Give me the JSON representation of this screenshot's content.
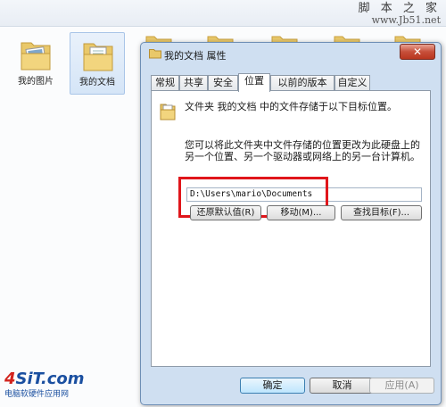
{
  "watermark": {
    "top_line1": "脚 本 之 家",
    "top_line2": "www.Jb51.net",
    "logo_text_part1": "4",
    "logo_text_part2": "SiT.com",
    "logo_sub": "电脑软硬件应用网"
  },
  "explorer": {
    "folders": [
      {
        "label": "我的图片",
        "selected": false
      },
      {
        "label": "我的文档",
        "selected": true
      }
    ]
  },
  "dialog": {
    "title": "我的文档 属性",
    "close_glyph": "✕",
    "tabs": [
      {
        "label": "常规",
        "active": false
      },
      {
        "label": "共享",
        "active": false
      },
      {
        "label": "安全",
        "active": false
      },
      {
        "label": "位置",
        "active": true
      },
      {
        "label": "以前的版本",
        "active": false
      },
      {
        "label": "自定义",
        "active": false
      }
    ],
    "heading": "文件夹 我的文档 中的文件存储于以下目标位置。",
    "description": "您可以将此文件夹中文件存储的位置更改为此硬盘上的另一个位置、另一个驱动器或网络上的另一台计算机。",
    "path_value": "D:\\Users\\mario\\Documents",
    "buttons": {
      "restore_default": "还原默认值(R)",
      "move": "移动(M)...",
      "find_target": "查找目标(F)...",
      "ok": "确定",
      "cancel": "取消",
      "apply": "应用(A)"
    }
  },
  "colors": {
    "highlight_box": "#e0161b",
    "dialog_frame": "#cfdff1",
    "folder_yellow": "#e9c86a"
  }
}
